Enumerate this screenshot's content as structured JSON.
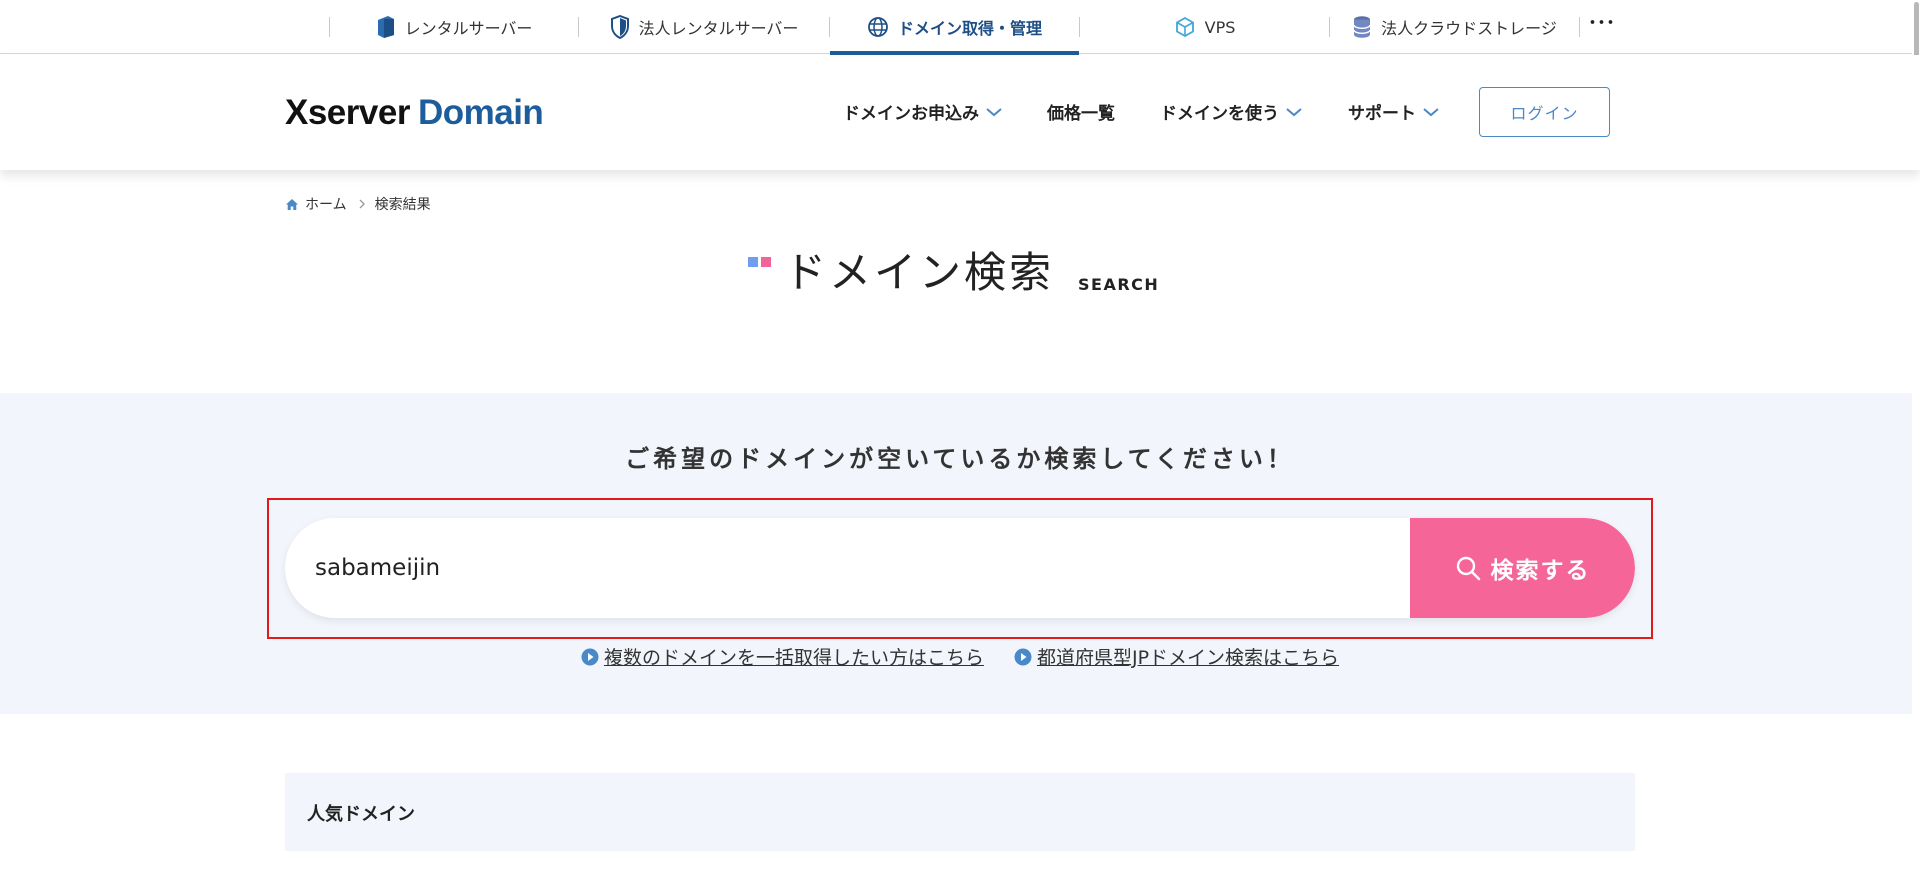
{
  "product_bar": {
    "tabs": [
      {
        "label": "レンタルサーバー",
        "icon": "rental-server-icon",
        "active": false
      },
      {
        "label": "法人レンタルサーバー",
        "icon": "shield-icon",
        "active": false
      },
      {
        "label": "ドメイン取得・管理",
        "icon": "globe-icon",
        "active": true
      },
      {
        "label": "VPS",
        "icon": "cube-icon",
        "active": false
      },
      {
        "label": "法人クラウドストレージ",
        "icon": "database-icon",
        "active": false
      }
    ],
    "more_label": "･･･"
  },
  "header": {
    "logo_part1": "Xserver",
    "logo_part2": "Domain",
    "nav": [
      {
        "label": "ドメインお申込み",
        "has_dropdown": true
      },
      {
        "label": "価格一覧",
        "has_dropdown": false
      },
      {
        "label": "ドメインを使う",
        "has_dropdown": true
      },
      {
        "label": "サポート",
        "has_dropdown": true
      }
    ],
    "login_label": "ログイン"
  },
  "breadcrumb": {
    "home": "ホーム",
    "current": "検索結果"
  },
  "page_title": {
    "main": "ドメイン検索",
    "sub": "SEARCH"
  },
  "search": {
    "heading": "ご希望のドメインが空いているか検索してください！",
    "value": "sabameijin",
    "button_label": "検索する",
    "links": [
      "複数のドメインを一括取得したい方はこちら",
      "都道府県型JPドメイン検索はこちら"
    ]
  },
  "popular": {
    "heading": "人気ドメイン"
  },
  "colors": {
    "brand_blue": "#1d5d9b",
    "accent_pink": "#f56597",
    "login_blue": "#4a89c8",
    "band_bg": "#f2f6fc",
    "highlight_red": "#e21a1a"
  }
}
